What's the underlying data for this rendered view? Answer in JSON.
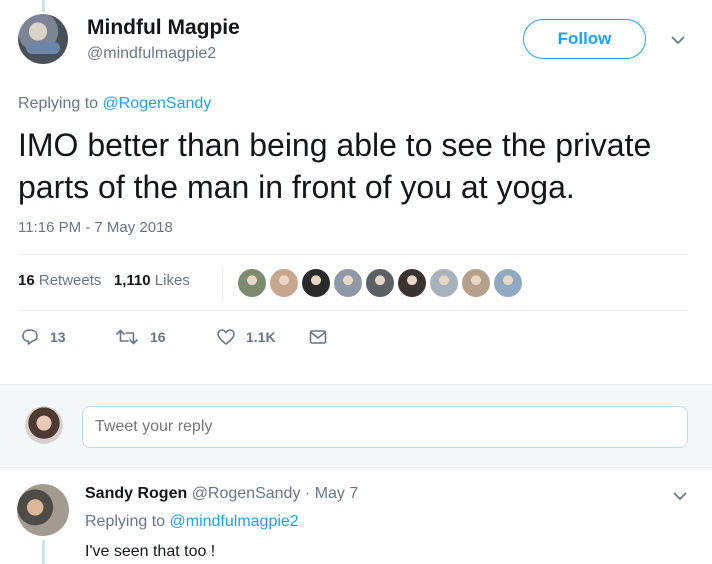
{
  "author": {
    "name": "Mindful Magpie",
    "handle": "@mindfulmagpie2",
    "follow_label": "Follow"
  },
  "tweet": {
    "replying_prefix": "Replying to",
    "replying_mention": "@RogenSandy",
    "text_line1": "IMO better than being able to see the private",
    "text_line2": "parts of the man in front of you at yoga.",
    "timestamp": "11:16 PM - 7 May 2018"
  },
  "stats": {
    "retweets_count": "16",
    "retweets_label": "Retweets",
    "likes_count": "1,110",
    "likes_label": "Likes"
  },
  "liker_avatars": [
    "#7c8a6e",
    "#c8a58d",
    "#2b2b2b",
    "#8e9aa6",
    "#5b5f66",
    "#3a3230",
    "#a7b3bc",
    "#b5a08c",
    "#8fa9c0"
  ],
  "actions": {
    "reply_count": "13",
    "retweet_count": "16",
    "like_count": "1.1K"
  },
  "compose": {
    "placeholder": "Tweet your reply"
  },
  "reply": {
    "name": "Sandy Rogen",
    "handle": "@RogenSandy",
    "separator": "·",
    "date": "May 7",
    "replying_prefix": "Replying to",
    "replying_mention": "@mindfulmagpie2",
    "text": "I've seen that too !"
  },
  "colors": {
    "accent": "#1da1f2",
    "muted": "#657786",
    "text": "#14171a",
    "thread_line": "#c7e3f5"
  }
}
